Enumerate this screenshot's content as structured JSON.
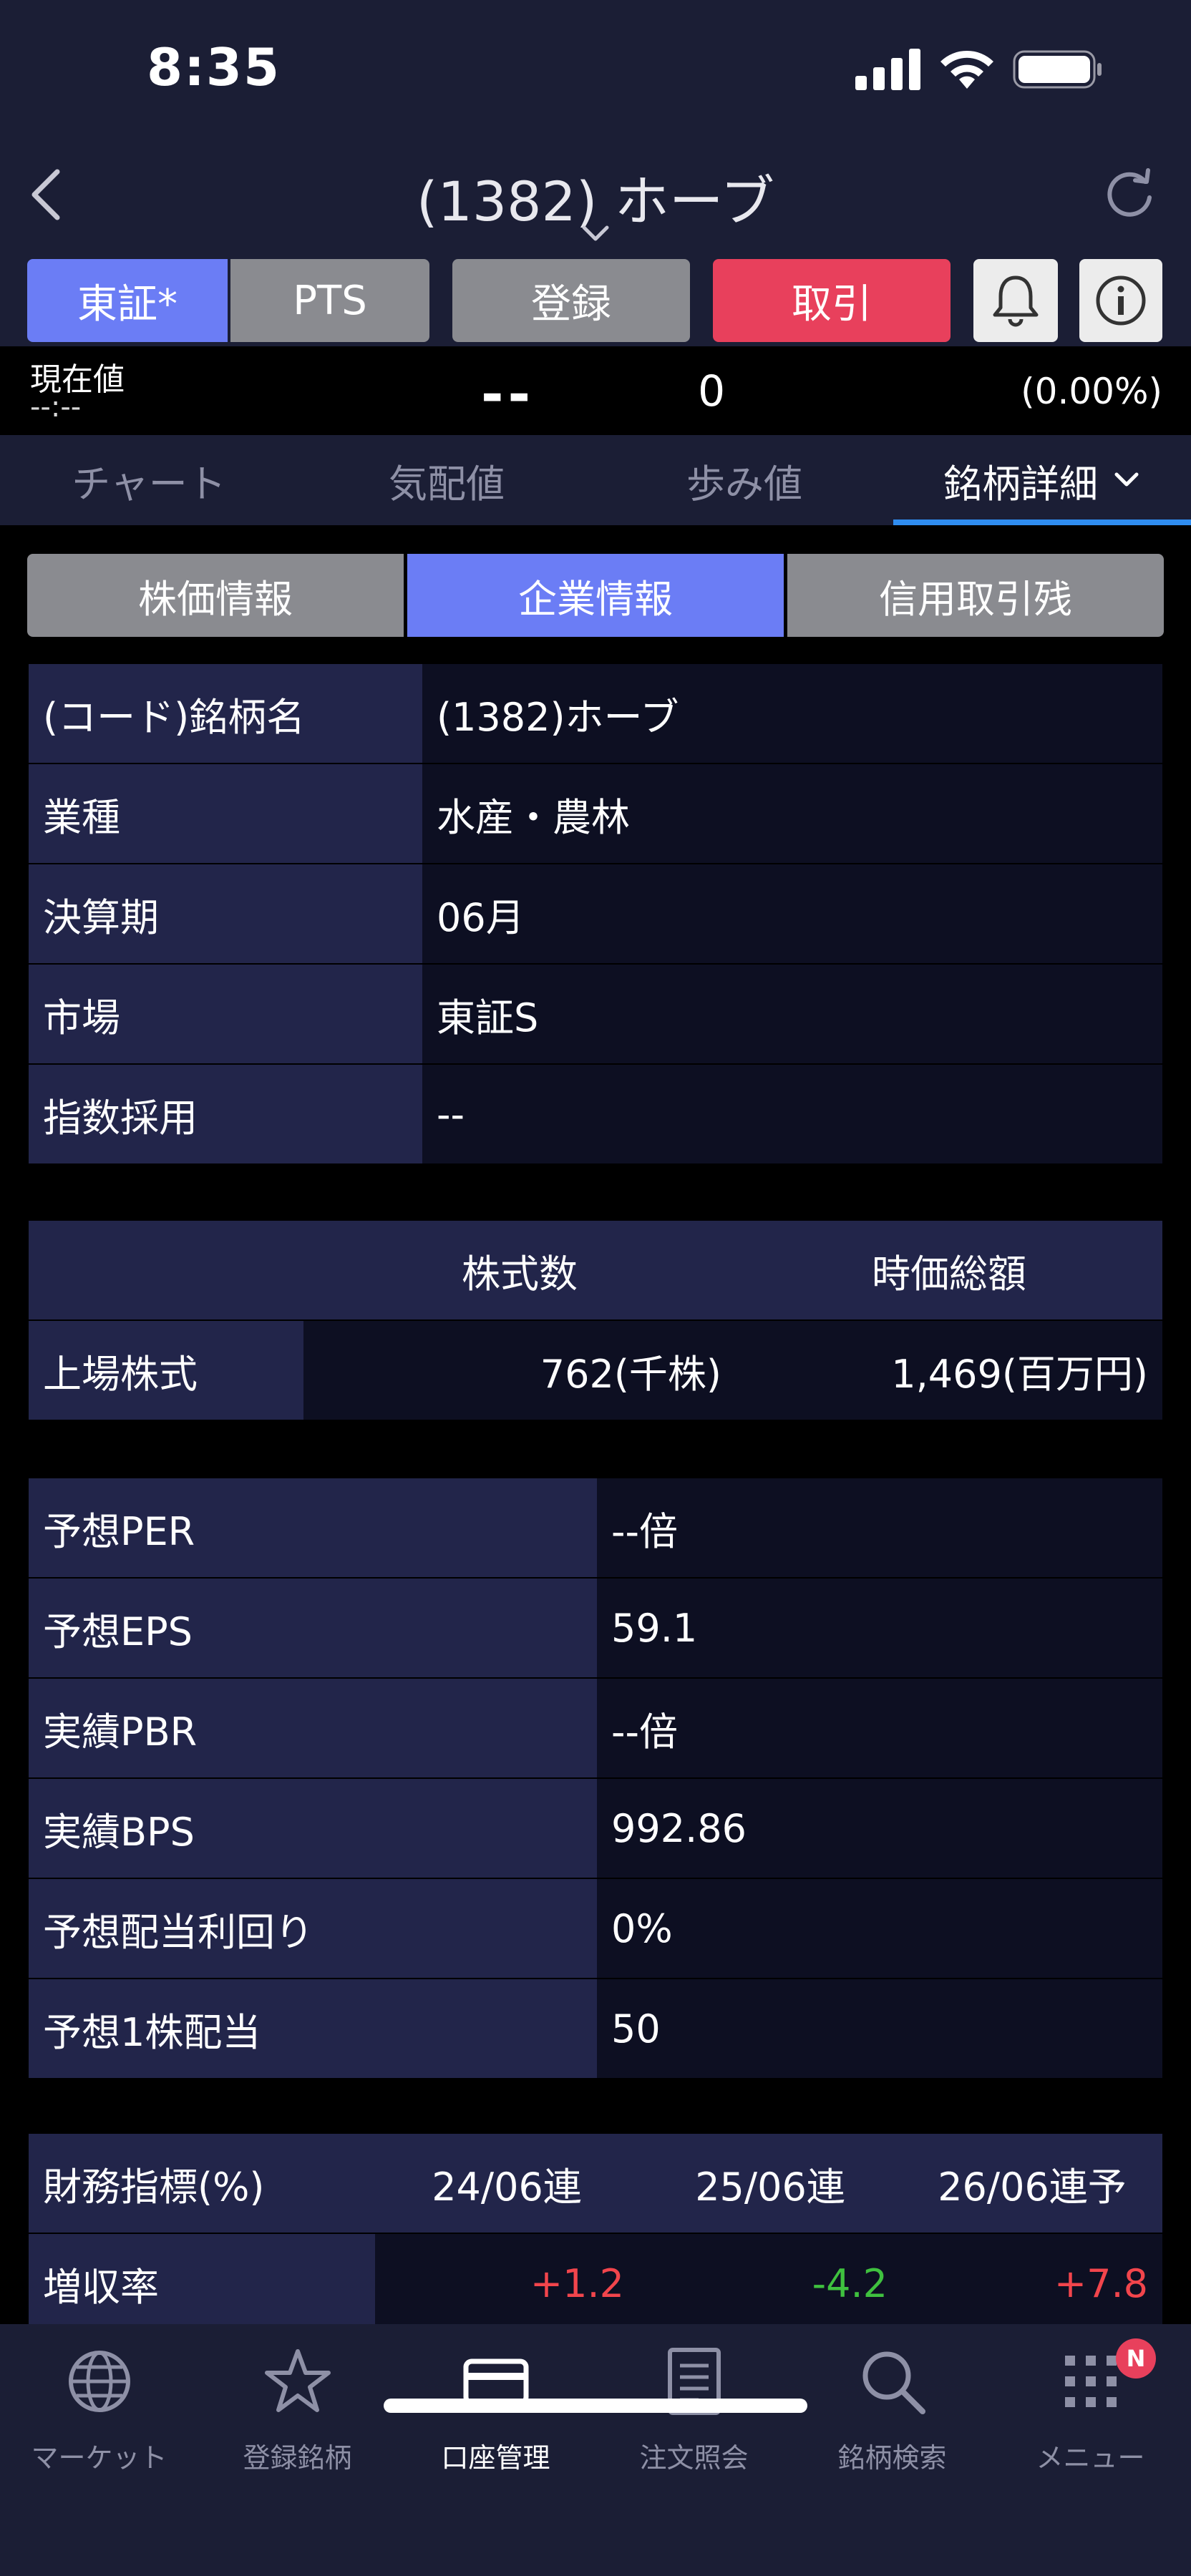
{
  "status_bar": {
    "time": "8:35"
  },
  "header": {
    "title": "(1382) ホーブ"
  },
  "buttons": {
    "tosho": "東証*",
    "pts": "PTS",
    "register": "登録",
    "trade": "取引"
  },
  "price": {
    "label": "現在値",
    "time": "--:--",
    "value": "--",
    "change": "0",
    "change_pct": "(0.00%)"
  },
  "tabs": [
    "チャート",
    "気配値",
    "歩み値",
    "銘柄詳細"
  ],
  "segments": [
    "株価情報",
    "企業情報",
    "信用取引残"
  ],
  "company_info": [
    {
      "label": "(コード)銘柄名",
      "value": "(1382)ホーブ"
    },
    {
      "label": "業種",
      "value": "水産・農林"
    },
    {
      "label": "決算期",
      "value": "06月"
    },
    {
      "label": "市場",
      "value": "東証S"
    },
    {
      "label": "指数採用",
      "value": "--"
    }
  ],
  "shares": {
    "col_shares": "株式数",
    "col_market_cap": "時価総額",
    "row_label": "上場株式",
    "shares_value": "762(千株)",
    "market_cap_value": "1,469(百万円)"
  },
  "indicators": [
    {
      "label": "予想PER",
      "value": "--倍"
    },
    {
      "label": "予想EPS",
      "value": "59.1"
    },
    {
      "label": "実績PBR",
      "value": "--倍"
    },
    {
      "label": "実績BPS",
      "value": "992.86"
    },
    {
      "label": "予想配当利回り",
      "value": "0%"
    },
    {
      "label": "予想1株配当",
      "value": "50"
    }
  ],
  "financial": {
    "header": [
      "財務指標(%)",
      "24/06連",
      "25/06連",
      "26/06連予"
    ],
    "row_label": "増収率",
    "values": [
      "+1.2",
      "-4.2",
      "+7.8"
    ],
    "colors": [
      "#f2454c",
      "#3fc13f",
      "#f2454c"
    ]
  },
  "bottom_nav": [
    {
      "label": "マーケット",
      "icon": "globe-icon"
    },
    {
      "label": "登録銘柄",
      "icon": "star-icon"
    },
    {
      "label": "口座管理",
      "icon": "card-icon"
    },
    {
      "label": "注文照会",
      "icon": "document-icon"
    },
    {
      "label": "銘柄検索",
      "icon": "search-icon"
    },
    {
      "label": "メニュー",
      "icon": "grid-icon",
      "badge": "N"
    }
  ]
}
